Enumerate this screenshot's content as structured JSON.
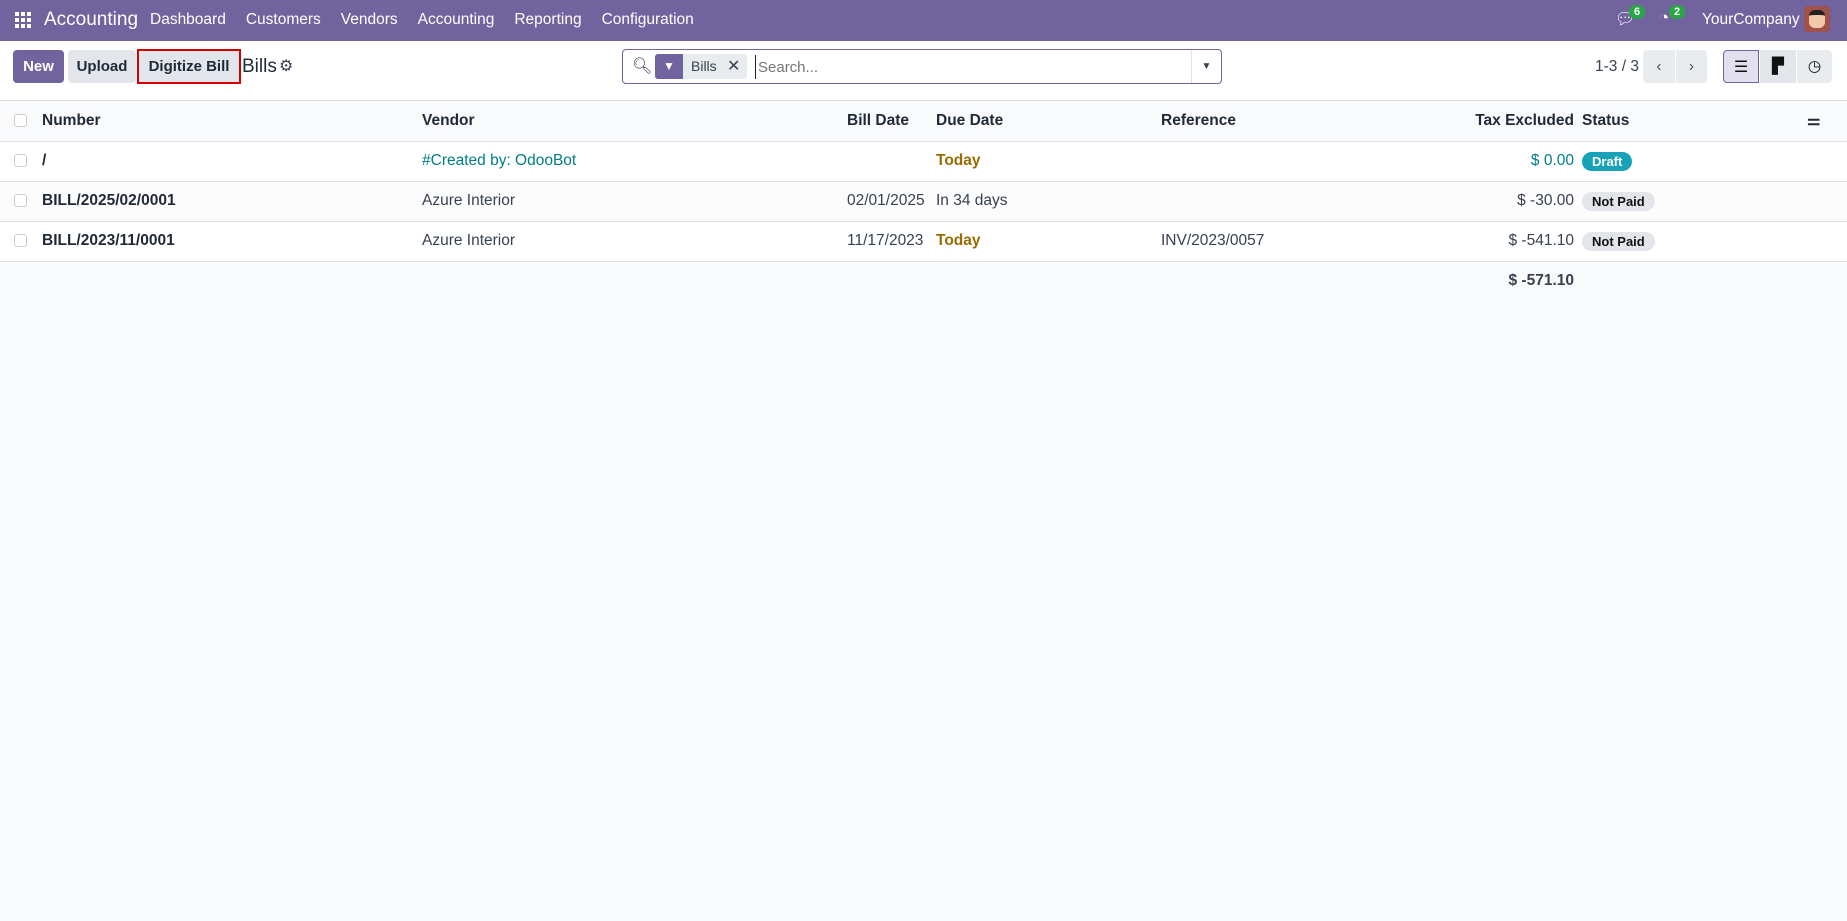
{
  "nav": {
    "app": "Accounting",
    "menu": [
      "Dashboard",
      "Customers",
      "Vendors",
      "Accounting",
      "Reporting",
      "Configuration"
    ],
    "messages_count": "6",
    "activities_count": "2",
    "company": "YourCompany"
  },
  "toolbar": {
    "new": "New",
    "upload": "Upload",
    "digitize": "Digitize Bill",
    "title": "Bills"
  },
  "search": {
    "facet": "Bills",
    "placeholder": "Search..."
  },
  "pager": {
    "text": "1-3 / 3"
  },
  "table": {
    "headers": [
      "Number",
      "Vendor",
      "Bill Date",
      "Due Date",
      "Reference",
      "Tax Excluded",
      "Status"
    ],
    "rows": [
      {
        "number": "/",
        "vendor": "#Created by: OdooBot",
        "bill_date": "",
        "due_date": "Today",
        "reference": "",
        "tax_excluded": "$ 0.00",
        "status": "Draft"
      },
      {
        "number": "BILL/2025/02/0001",
        "vendor": "Azure Interior",
        "bill_date": "02/01/2025",
        "due_date": "In 34 days",
        "reference": "",
        "tax_excluded": "$ -30.00",
        "status": "Not Paid"
      },
      {
        "number": "BILL/2023/11/0001",
        "vendor": "Azure Interior",
        "bill_date": "11/17/2023",
        "due_date": "Today",
        "reference": "INV/2023/0057",
        "tax_excluded": "$ -541.10",
        "status": "Not Paid"
      }
    ],
    "total": "$ -571.10"
  },
  "colors": {
    "brand": "#71639e",
    "draft": "#17a2b8",
    "today": "#9a6b00",
    "link": "#017e84"
  }
}
